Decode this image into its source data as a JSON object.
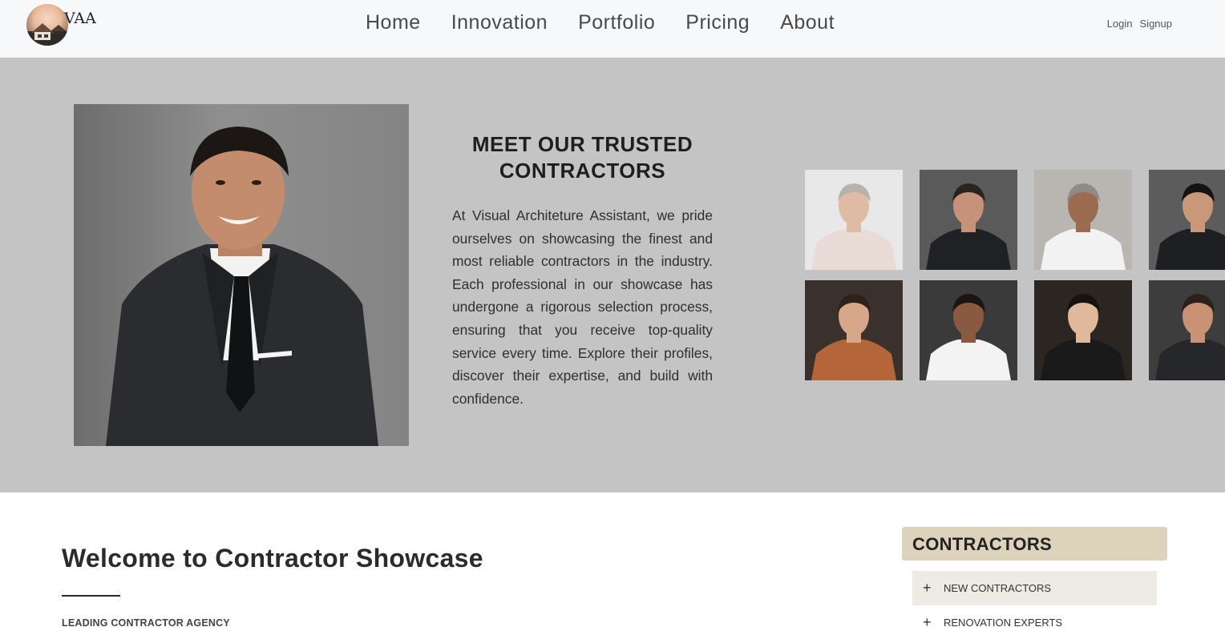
{
  "header": {
    "logo_text": "VAA",
    "nav": [
      "Home",
      "Innovation",
      "Portfolio",
      "Pricing",
      "About"
    ],
    "login_label": "Login",
    "signup_label": "Signup"
  },
  "hero": {
    "title": "MEET OUR TRUSTED CONTRACTORS",
    "body": "At Visual Architeture Assistant, we pride ourselves on showcasing the finest and most reliable contractors in the industry. Each professional in our showcase has undergone a rigorous selection process, ensuring that you receive top-quality service every time. Explore their profiles, discover their expertise, and build with confidence.",
    "thumbnails": [
      {
        "name": "contractor-portrait-1",
        "bg": "#e8e8e8",
        "suit": "#e9dcd6",
        "skin": "#e0bba3",
        "hair": "#b8b2aa"
      },
      {
        "name": "contractor-portrait-2",
        "bg": "#5a5a5a",
        "suit": "#1f2125",
        "skin": "#c69378",
        "hair": "#2a2420"
      },
      {
        "name": "contractor-portrait-3",
        "bg": "#b9b6b2",
        "suit": "#f2f2f2",
        "skin": "#9b6b4f",
        "hair": "#8e8a86"
      },
      {
        "name": "contractor-portrait-4",
        "bg": "#5c5c5c",
        "suit": "#1d1f22",
        "skin": "#c99878",
        "hair": "#15120f"
      },
      {
        "name": "contractor-portrait-5",
        "bg": "#3a312c",
        "suit": "#b5653a",
        "skin": "#d8a78a",
        "hair": "#2e211a"
      },
      {
        "name": "contractor-portrait-6",
        "bg": "#3a3a3a",
        "suit": "#f3f3f3",
        "skin": "#8a5a40",
        "hair": "#1a1512"
      },
      {
        "name": "contractor-portrait-7",
        "bg": "#2b2622",
        "suit": "#1a1a1a",
        "skin": "#e0b89c",
        "hair": "#161210"
      },
      {
        "name": "contractor-portrait-8",
        "bg": "#3d3d3d",
        "suit": "#25272b",
        "skin": "#c99275",
        "hair": "#2a211b"
      }
    ]
  },
  "main": {
    "welcome_title": "Welcome to Contractor Showcase",
    "welcome_subtitle": "LEADING CONTRACTOR AGENCY"
  },
  "categories": {
    "heading": "CONTRACTORS CATEGORIES",
    "items": [
      "NEW CONTRACTORS",
      "RENOVATION EXPERTS"
    ],
    "expand_symbol": "+"
  }
}
